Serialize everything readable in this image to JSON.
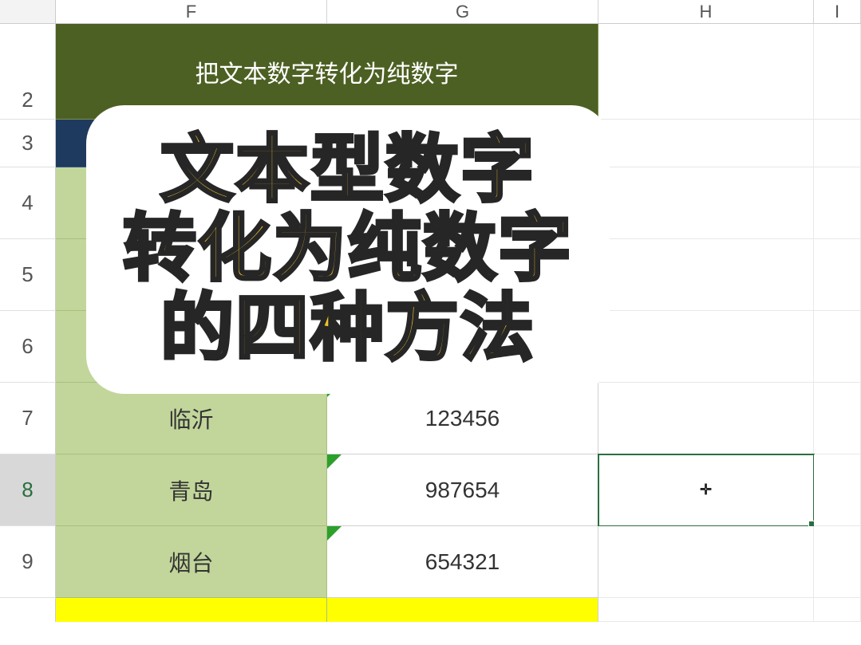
{
  "columns": {
    "F": "F",
    "G": "G",
    "H": "H",
    "I": "I"
  },
  "row_labels": {
    "r2": "2",
    "r3": "3",
    "r4": "4",
    "r5": "5",
    "r6": "6",
    "r7": "7",
    "r8": "8",
    "r9": "9"
  },
  "title_cell": "把文本数字转化为纯数字",
  "rows": {
    "r7": {
      "city": "临沂",
      "value": "123456"
    },
    "r8": {
      "city": "青岛",
      "value": "987654"
    },
    "r9": {
      "city": "烟台",
      "value": "654321"
    }
  },
  "selected_cell": "H8",
  "cursor": "✥",
  "overlay": {
    "line1": "文本型数字",
    "line2": "转化为纯数字",
    "line3": "的四种方法"
  }
}
